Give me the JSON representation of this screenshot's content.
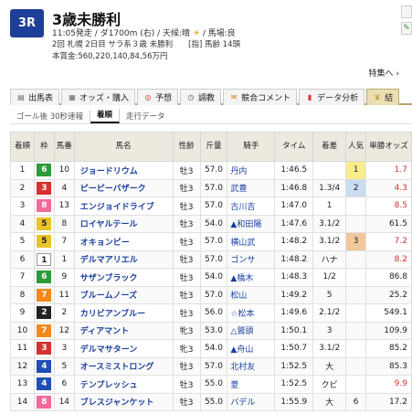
{
  "race": {
    "badge": "3R",
    "title": "3歳未勝利",
    "info1_a": "11:05発走 / ダ1700m (右) / 天候:晴",
    "info1_b": "/ 馬場:良",
    "info2": "2回 札幌 2日目 サラ系３歳 未勝利　　[指] 馬齢 14頭",
    "info3": "本賞金:560,220,140,84,56万円"
  },
  "tokushu": "特集へ ›",
  "tabs": [
    {
      "label": "出馬表",
      "icon": "list-icon"
    },
    {
      "label": "オッズ・購入",
      "icon": "odds-icon"
    },
    {
      "label": "予想",
      "icon": "target-icon"
    },
    {
      "label": "調教",
      "icon": "stopwatch-icon"
    },
    {
      "label": "競合コメント",
      "icon": "comment-icon"
    },
    {
      "label": "データ分析",
      "icon": "chart-icon"
    },
    {
      "label": "結",
      "icon": "result-icon"
    }
  ],
  "subtabs": [
    "ゴール後 30秒速報",
    "着順",
    "走行データ"
  ],
  "headers": [
    "着順",
    "枠",
    "馬番",
    "馬名",
    "性齢",
    "斤量",
    "騎手",
    "タイム",
    "着差",
    "人気",
    "単勝オッズ"
  ],
  "colors": {
    "w1": "#ffffff",
    "w2": "#222222",
    "w3": "#d63131",
    "w4": "#1f4fb5",
    "w5": "#e8c32a",
    "w6": "#2e9a3a",
    "w7": "#f08a1c",
    "w8": "#f26a9c"
  },
  "rows": [
    {
      "rank": "1",
      "waku": "6",
      "num": "10",
      "name": "ジョードリウム",
      "sex": "牡3",
      "wt": "57.0",
      "jockey": "丹内",
      "time": "1:46.5",
      "diff": "",
      "pop": "1",
      "odds": "1.7"
    },
    {
      "rank": "2",
      "waku": "3",
      "num": "4",
      "name": "ピーピーバザーク",
      "sex": "牡3",
      "wt": "57.0",
      "jockey": "武豊",
      "time": "1:46.8",
      "diff": "1.3/4",
      "pop": "2",
      "odds": "4.3"
    },
    {
      "rank": "3",
      "waku": "8",
      "num": "13",
      "name": "エンジョイドライブ",
      "sex": "牡3",
      "wt": "57.0",
      "jockey": "古川吉",
      "time": "1:47.0",
      "diff": "1",
      "pop": "",
      "odds": "8.5"
    },
    {
      "rank": "4",
      "waku": "5",
      "num": "8",
      "name": "ロイヤルテール",
      "sex": "牡3",
      "wt": "54.0",
      "jockey": "▲和田陽",
      "time": "1:47.6",
      "diff": "3.1/2",
      "pop": "",
      "odds": "61.5"
    },
    {
      "rank": "5",
      "waku": "5",
      "num": "7",
      "name": "オキョンビー",
      "sex": "牡3",
      "wt": "57.0",
      "jockey": "横山武",
      "time": "1:48.2",
      "diff": "3.1/2",
      "pop": "3",
      "odds": "7.2"
    },
    {
      "rank": "6",
      "waku": "1",
      "num": "1",
      "name": "デルマアリエル",
      "sex": "牡3",
      "wt": "57.0",
      "jockey": "ゴンサ",
      "time": "1:48.2",
      "diff": "ハナ",
      "pop": "",
      "odds": "8.2"
    },
    {
      "rank": "7",
      "waku": "6",
      "num": "9",
      "name": "サザンブラック",
      "sex": "牡3",
      "wt": "54.0",
      "jockey": "▲橋木",
      "time": "1:48.3",
      "diff": "1/2",
      "pop": "",
      "odds": "86.8"
    },
    {
      "rank": "8",
      "waku": "7",
      "num": "11",
      "name": "ブルームノーズ",
      "sex": "牡3",
      "wt": "57.0",
      "jockey": "松山",
      "time": "1:49.2",
      "diff": "5",
      "pop": "",
      "odds": "25.2"
    },
    {
      "rank": "9",
      "waku": "2",
      "num": "2",
      "name": "カリビアンブルー",
      "sex": "牡3",
      "wt": "56.0",
      "jockey": "☆松本",
      "time": "1:49.6",
      "diff": "2.1/2",
      "pop": "",
      "odds": "549.1"
    },
    {
      "rank": "10",
      "waku": "7",
      "num": "12",
      "name": "ディアマント",
      "sex": "牝3",
      "wt": "53.0",
      "jockey": "△鷲頭",
      "time": "1:50.1",
      "diff": "3",
      "pop": "",
      "odds": "109.9"
    },
    {
      "rank": "11",
      "waku": "3",
      "num": "3",
      "name": "デルマサターン",
      "sex": "牝3",
      "wt": "54.0",
      "jockey": "▲舟山",
      "time": "1:50.7",
      "diff": "3.1/2",
      "pop": "",
      "odds": "85.2"
    },
    {
      "rank": "12",
      "waku": "4",
      "num": "5",
      "name": "オースミストロング",
      "sex": "牡3",
      "wt": "57.0",
      "jockey": "北村友",
      "time": "1:52.5",
      "diff": "大",
      "pop": "",
      "odds": "85.3"
    },
    {
      "rank": "13",
      "waku": "4",
      "num": "6",
      "name": "テンプレッシュ",
      "sex": "牡3",
      "wt": "55.0",
      "jockey": "菱",
      "time": "1:52.5",
      "diff": "クビ",
      "pop": "",
      "odds": "9.9"
    },
    {
      "rank": "14",
      "waku": "8",
      "num": "14",
      "name": "ブレスジャンケット",
      "sex": "牡3",
      "wt": "55.0",
      "jockey": "バデル",
      "time": "1:55.9",
      "diff": "大",
      "pop": "6",
      "odds": "17.2"
    }
  ]
}
